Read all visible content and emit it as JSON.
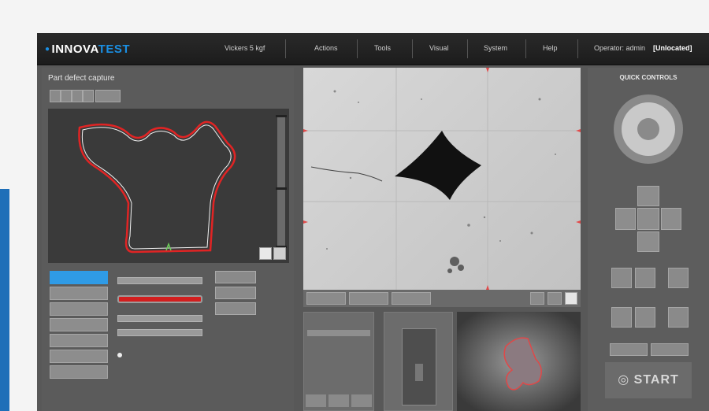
{
  "brand": {
    "name_prefix": "INNOVA",
    "name_suffix": "TEST"
  },
  "header": {
    "title": "Vickers 5 kgf",
    "menu": [
      "Actions",
      "Tools",
      "Visual",
      "System",
      "Help"
    ],
    "operator": "Operator: admin",
    "status": "[Unlocated]"
  },
  "left": {
    "title": "Part defect capture"
  },
  "quick": {
    "title": "QUICK CONTROLS",
    "start": "START"
  },
  "colors": {
    "accent": "#2f9be6",
    "alert": "#d21e1e",
    "topbar": "#1f1f1f"
  }
}
